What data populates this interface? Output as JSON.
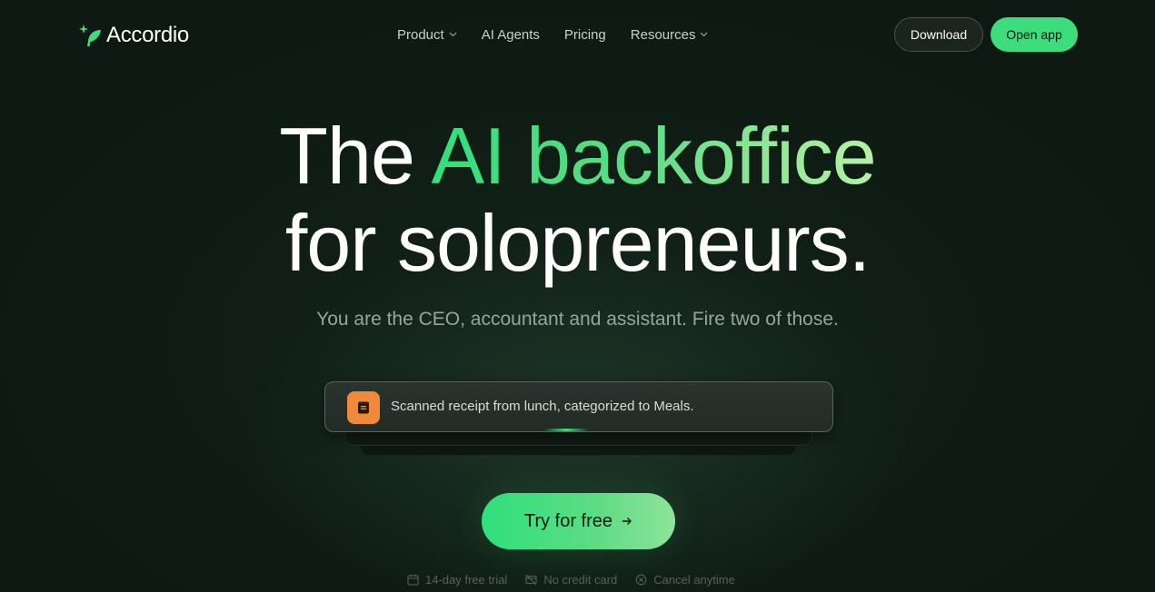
{
  "brand": {
    "name": "Accordio",
    "logo_icon": "leaf-sparkle-icon"
  },
  "nav": {
    "links": [
      {
        "label": "Product",
        "has_dropdown": true
      },
      {
        "label": "AI Agents",
        "has_dropdown": false
      },
      {
        "label": "Pricing",
        "has_dropdown": false
      },
      {
        "label": "Resources",
        "has_dropdown": true
      }
    ],
    "download_label": "Download",
    "open_app_label": "Open app"
  },
  "hero": {
    "title_plain_1": "The ",
    "title_accent": "AI backoffice",
    "title_line_2": "for solopreneurs.",
    "subtitle": "You are the CEO, accountant and assistant. Fire two of those."
  },
  "activity": {
    "icon": "receipt-icon",
    "text": "Scanned receipt from lunch, categorized to Meals."
  },
  "cta": {
    "label": "Try for free",
    "icon": "arrow-right-icon"
  },
  "perks": [
    {
      "icon": "calendar-icon",
      "label": "14-day free trial"
    },
    {
      "icon": "no-credit-card-icon",
      "label": "No credit card"
    },
    {
      "icon": "cancel-circle-icon",
      "label": "Cancel anytime"
    }
  ],
  "colors": {
    "background": "#0d1912",
    "accent": "#3ddc7c",
    "accent_light": "#b8f0a8",
    "activity_icon_bg": "#ee8a3a"
  }
}
